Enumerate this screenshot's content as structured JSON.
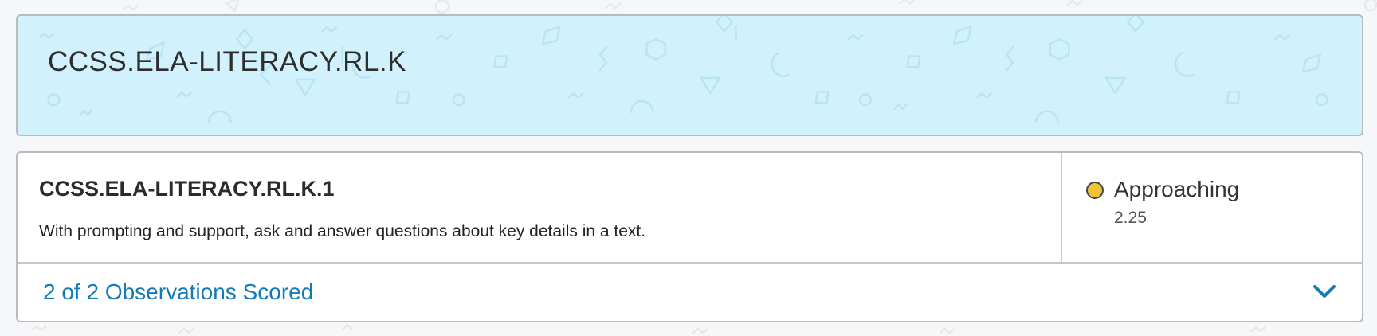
{
  "standard": {
    "title": "CCSS.ELA-LITERACY.RL.K"
  },
  "substandard": {
    "code": "CCSS.ELA-LITERACY.RL.K.1",
    "description": "With prompting and support, ask and answer questions about key details in a text."
  },
  "status": {
    "label": "Approaching",
    "score": "2.25",
    "color": "#f1c232",
    "icon": "status-dot-icon"
  },
  "observations": {
    "label": "2 of 2 Observations Scored",
    "icon": "chevron-down-icon"
  },
  "colors": {
    "header_bg": "#d1f1fc",
    "link": "#1579b5"
  }
}
